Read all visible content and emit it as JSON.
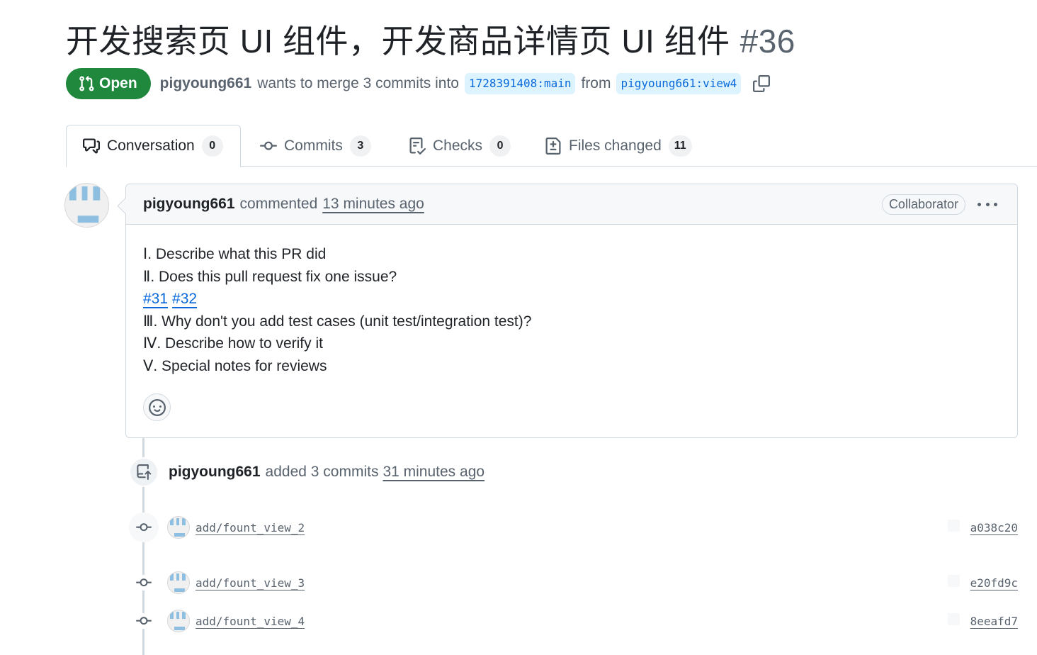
{
  "pr": {
    "title": "开发搜索页 UI 组件，开发商品详情页 UI 组件",
    "number": "#36",
    "state": "Open",
    "author": "pigyoung661",
    "merge_text": "wants to merge 3 commits into",
    "base_branch": "1728391408:main",
    "from_text": "from",
    "head_branch": "pigyoung661:view4"
  },
  "tabs": [
    {
      "label": "Conversation",
      "count": "0",
      "icon": "comment-discussion-icon"
    },
    {
      "label": "Commits",
      "count": "3",
      "icon": "git-commit-icon"
    },
    {
      "label": "Checks",
      "count": "0",
      "icon": "checklist-icon"
    },
    {
      "label": "Files changed",
      "count": "11",
      "icon": "file-diff-icon"
    }
  ],
  "comment": {
    "author": "pigyoung661",
    "action": "commented",
    "time": "13 minutes ago",
    "role": "Collaborator",
    "lines": [
      "Ⅰ. Describe what this PR did",
      "Ⅱ. Does this pull request fix one issue?",
      "Ⅲ. Why don't you add test cases (unit test/integration test)?",
      "Ⅳ. Describe how to verify it",
      "Ⅴ. Special notes for reviews"
    ],
    "issue_links": [
      "#31",
      "#32"
    ]
  },
  "push_event": {
    "author": "pigyoung661",
    "text": "added 3 commits",
    "time": "31 minutes ago"
  },
  "commits": [
    {
      "message": "add/fount_view_2",
      "sha": "a038c20"
    },
    {
      "message": "add/fount_view_3",
      "sha": "e20fd9c"
    },
    {
      "message": "add/fount_view_4",
      "sha": "8eeafd7"
    }
  ],
  "colors": {
    "open_green": "#1f883d",
    "link_blue": "#0969da",
    "branch_bg": "#ddf4ff",
    "muted_text": "#59636e",
    "border": "#d1d9e0"
  }
}
